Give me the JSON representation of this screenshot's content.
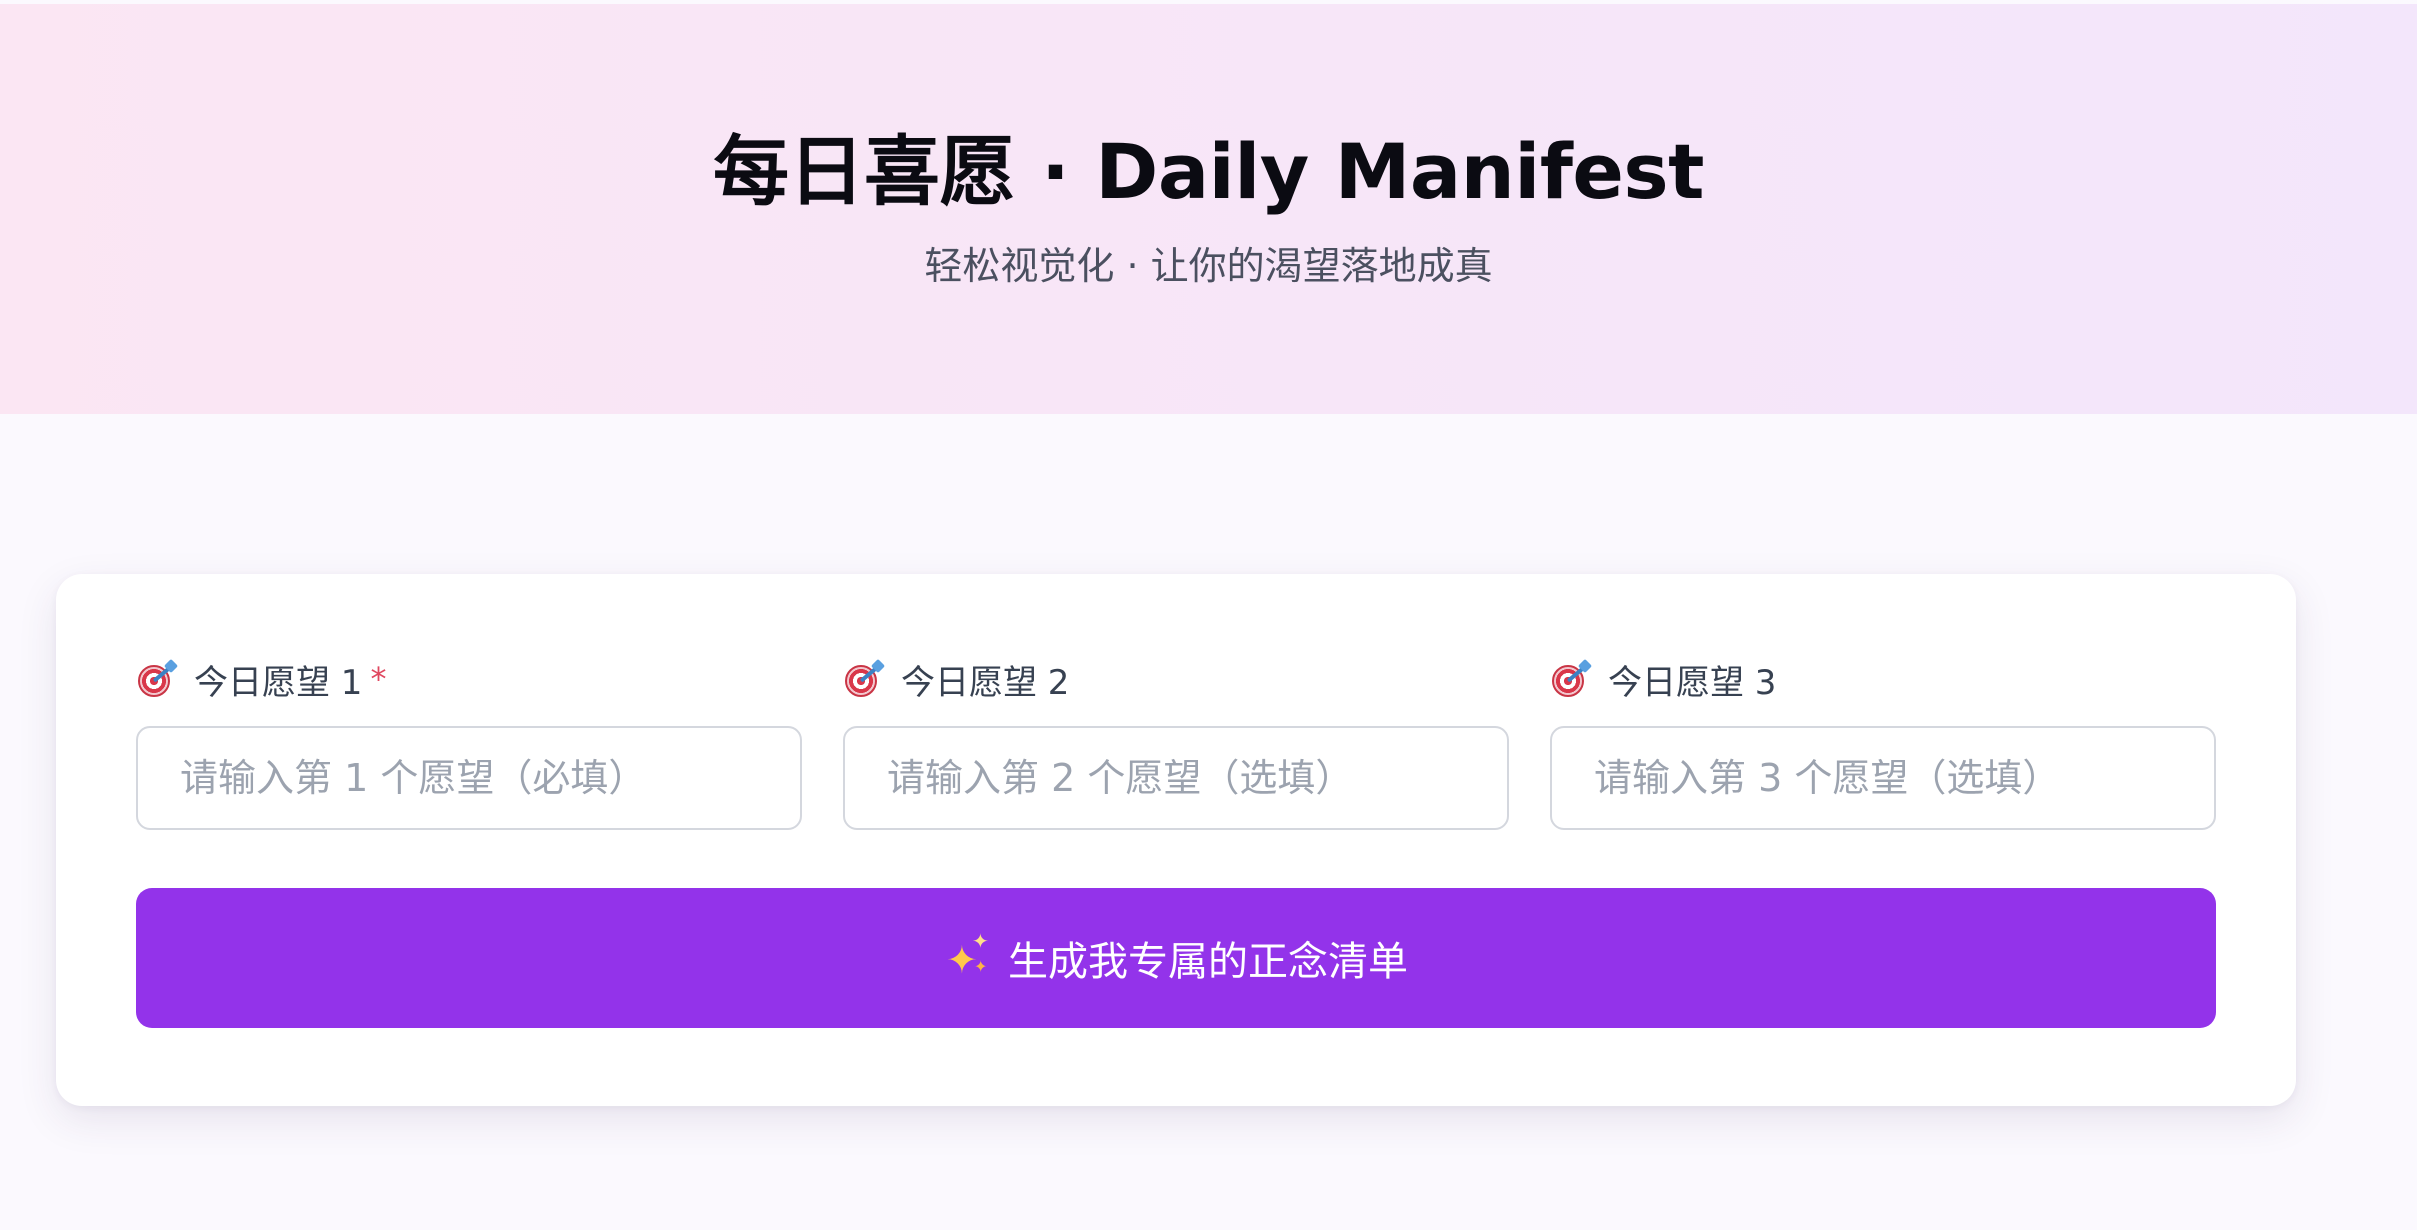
{
  "header": {
    "title": "每日喜愿 · Daily Manifest",
    "subtitle": "轻松视觉化 · 让你的渴望落地成真"
  },
  "form": {
    "fields": [
      {
        "label": "今日愿望 1",
        "required_mark": "*",
        "placeholder": "请输入第 1 个愿望（必填）",
        "icon": "target-icon"
      },
      {
        "label": "今日愿望 2",
        "placeholder": "请输入第 2 个愿望（选填）",
        "icon": "target-icon"
      },
      {
        "label": "今日愿望 3",
        "placeholder": "请输入第 3 个愿望（选填）",
        "icon": "target-icon"
      }
    ],
    "submit": {
      "label": "生成我专属的正念清单",
      "icon": "sparkles-icon"
    }
  },
  "colors": {
    "accent": "#9333ea",
    "required": "#e0475f",
    "hero_gradient_start": "#fbe6f3",
    "hero_gradient_end": "#f3e6fb",
    "page_background": "#fbf9fe"
  }
}
